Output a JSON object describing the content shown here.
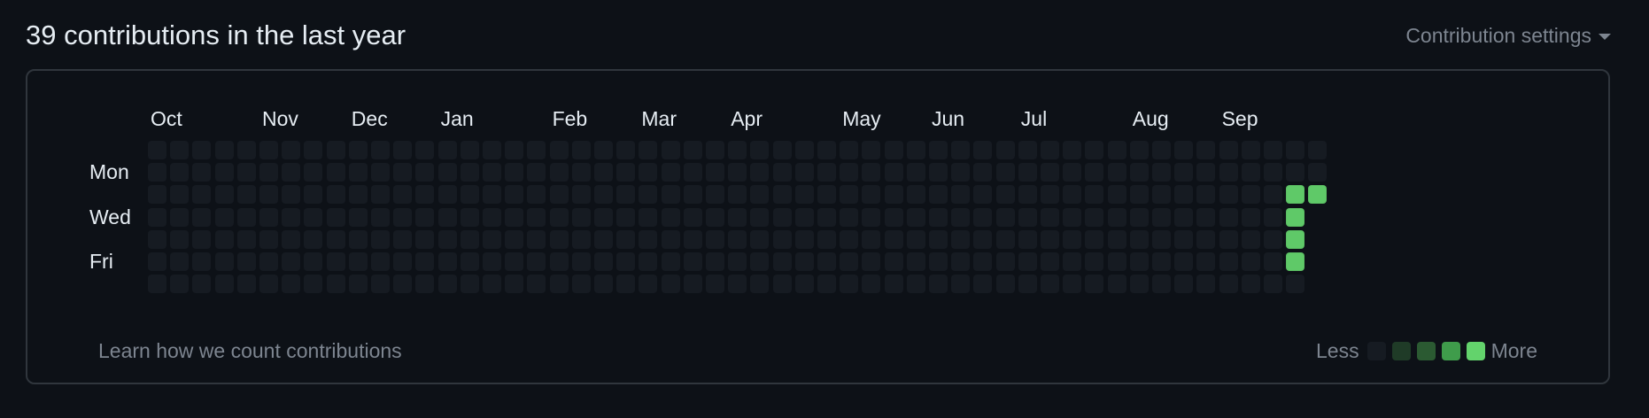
{
  "header": {
    "title": "39 contributions in the last year",
    "settings_label": "Contribution settings"
  },
  "calendar": {
    "months": [
      "Oct",
      "Nov",
      "Dec",
      "Jan",
      "Feb",
      "Mar",
      "Apr",
      "May",
      "Jun",
      "Jul",
      "Aug",
      "Sep"
    ],
    "day_labels": [
      "Mon",
      "Wed",
      "Fri"
    ],
    "weeks": 53,
    "levels_by_week_day": {
      "51": {
        "2": 3,
        "3": 3,
        "4": 3,
        "5": 3,
        "6": 0
      },
      "52": {
        "0": 0,
        "1": 0,
        "2": 3
      }
    },
    "last_week_days": 3
  },
  "footer": {
    "learn_link": "Learn how we count contributions",
    "legend_less": "Less",
    "legend_more": "More"
  },
  "colors": {
    "level0": "#161b22",
    "level1": "#0e4429",
    "level2": "#006d32",
    "level3": "#26a641",
    "level4": "#39d353",
    "legend1": "#1f3b27",
    "legend2": "#2b5a32",
    "legend3": "#3f9c4b",
    "legend4": "#63d36c",
    "active": "#5fc968"
  }
}
